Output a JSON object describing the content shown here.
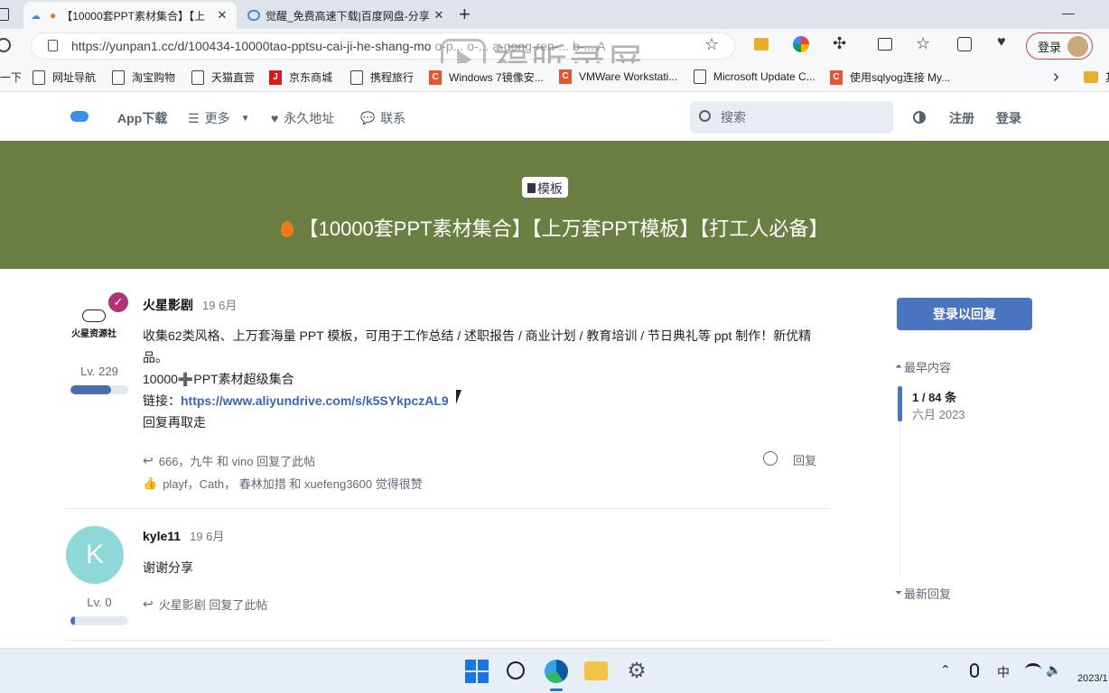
{
  "browser": {
    "tabs": [
      {
        "title": "【10000套PPT素材集合】【上",
        "active": true
      },
      {
        "title": "觉醒_免费高速下载|百度网盘-分享",
        "active": false
      }
    ],
    "new_tab": "+",
    "url": "https://yunpan1.cc/d/100434-10000tao-pptsu-cai-ji-he-shang-mo",
    "url_tail": "o-p... o-... a-gong-ren-... b-... A",
    "watermark": "福昕录屏",
    "login_label": "登录",
    "window_minimize": "—",
    "bookmarks": [
      {
        "label": "一下",
        "icon": "none"
      },
      {
        "label": "网址导航",
        "icon": "page"
      },
      {
        "label": "淘宝购物",
        "icon": "page"
      },
      {
        "label": "天猫直营",
        "icon": "page"
      },
      {
        "label": "京东商城",
        "icon": "jd"
      },
      {
        "label": "携程旅行",
        "icon": "page"
      },
      {
        "label": "Windows 7镜像安...",
        "icon": "c"
      },
      {
        "label": "VMWare Workstati...",
        "icon": "c"
      },
      {
        "label": "Microsoft Update C...",
        "icon": "page"
      },
      {
        "label": "使用sqlyog连接 My...",
        "icon": "c"
      }
    ],
    "bookmarks_more": "›",
    "bookmark_folder": "其"
  },
  "site": {
    "nav": {
      "app_download": "App下载",
      "more": "更多",
      "permanent": "永久地址",
      "contact": "联系",
      "search_placeholder": "搜索",
      "register": "注册",
      "login": "登录"
    },
    "hero": {
      "tag": "模板",
      "title": "【10000套PPT素材集合】【上万套PPT模板】【打工人必备】",
      "color": "#6b7f43"
    }
  },
  "posts": [
    {
      "username": "火星影剧",
      "date": "19 6月",
      "avatar_text": "火星资源社",
      "level": "Lv. 229",
      "level_progress": 0.7,
      "content_line1": "收集62类风格、上万套海量 PPT 模板，可用于工作总结 / 述职报告 / 商业计划 / 教育培训 / 节日典礼等 ppt 制作！新优精",
      "content_line2": "品。",
      "content_line3": "10000➕PPT素材超级集合",
      "link_prefix": "链接：",
      "link": "https://www.aliyundrive.com/s/k5SYkpczAL9",
      "content_line5": "回复再取走",
      "replied_by": "666，九牛 和 vino 回复了此帖",
      "liked_by": "playf，Cath， 春林加措 和 xuefeng3600 觉得很赞",
      "reply_label": "回复"
    },
    {
      "username": "kyle11",
      "date": "19 6月",
      "avatar_letter": "K",
      "avatar_color": "#8fd8d8",
      "level": "Lv. 0",
      "level_progress": 0.08,
      "content": "谢谢分享",
      "replied_by": "火星影剧 回复了此帖"
    }
  ],
  "sidebar": {
    "reply_button": "登录以回复",
    "earliest": "最早内容",
    "position": "1 / 84 条",
    "month": "六月 2023",
    "latest": "最新回复"
  },
  "taskbar": {
    "ime": "中",
    "clock": "2023/1"
  }
}
